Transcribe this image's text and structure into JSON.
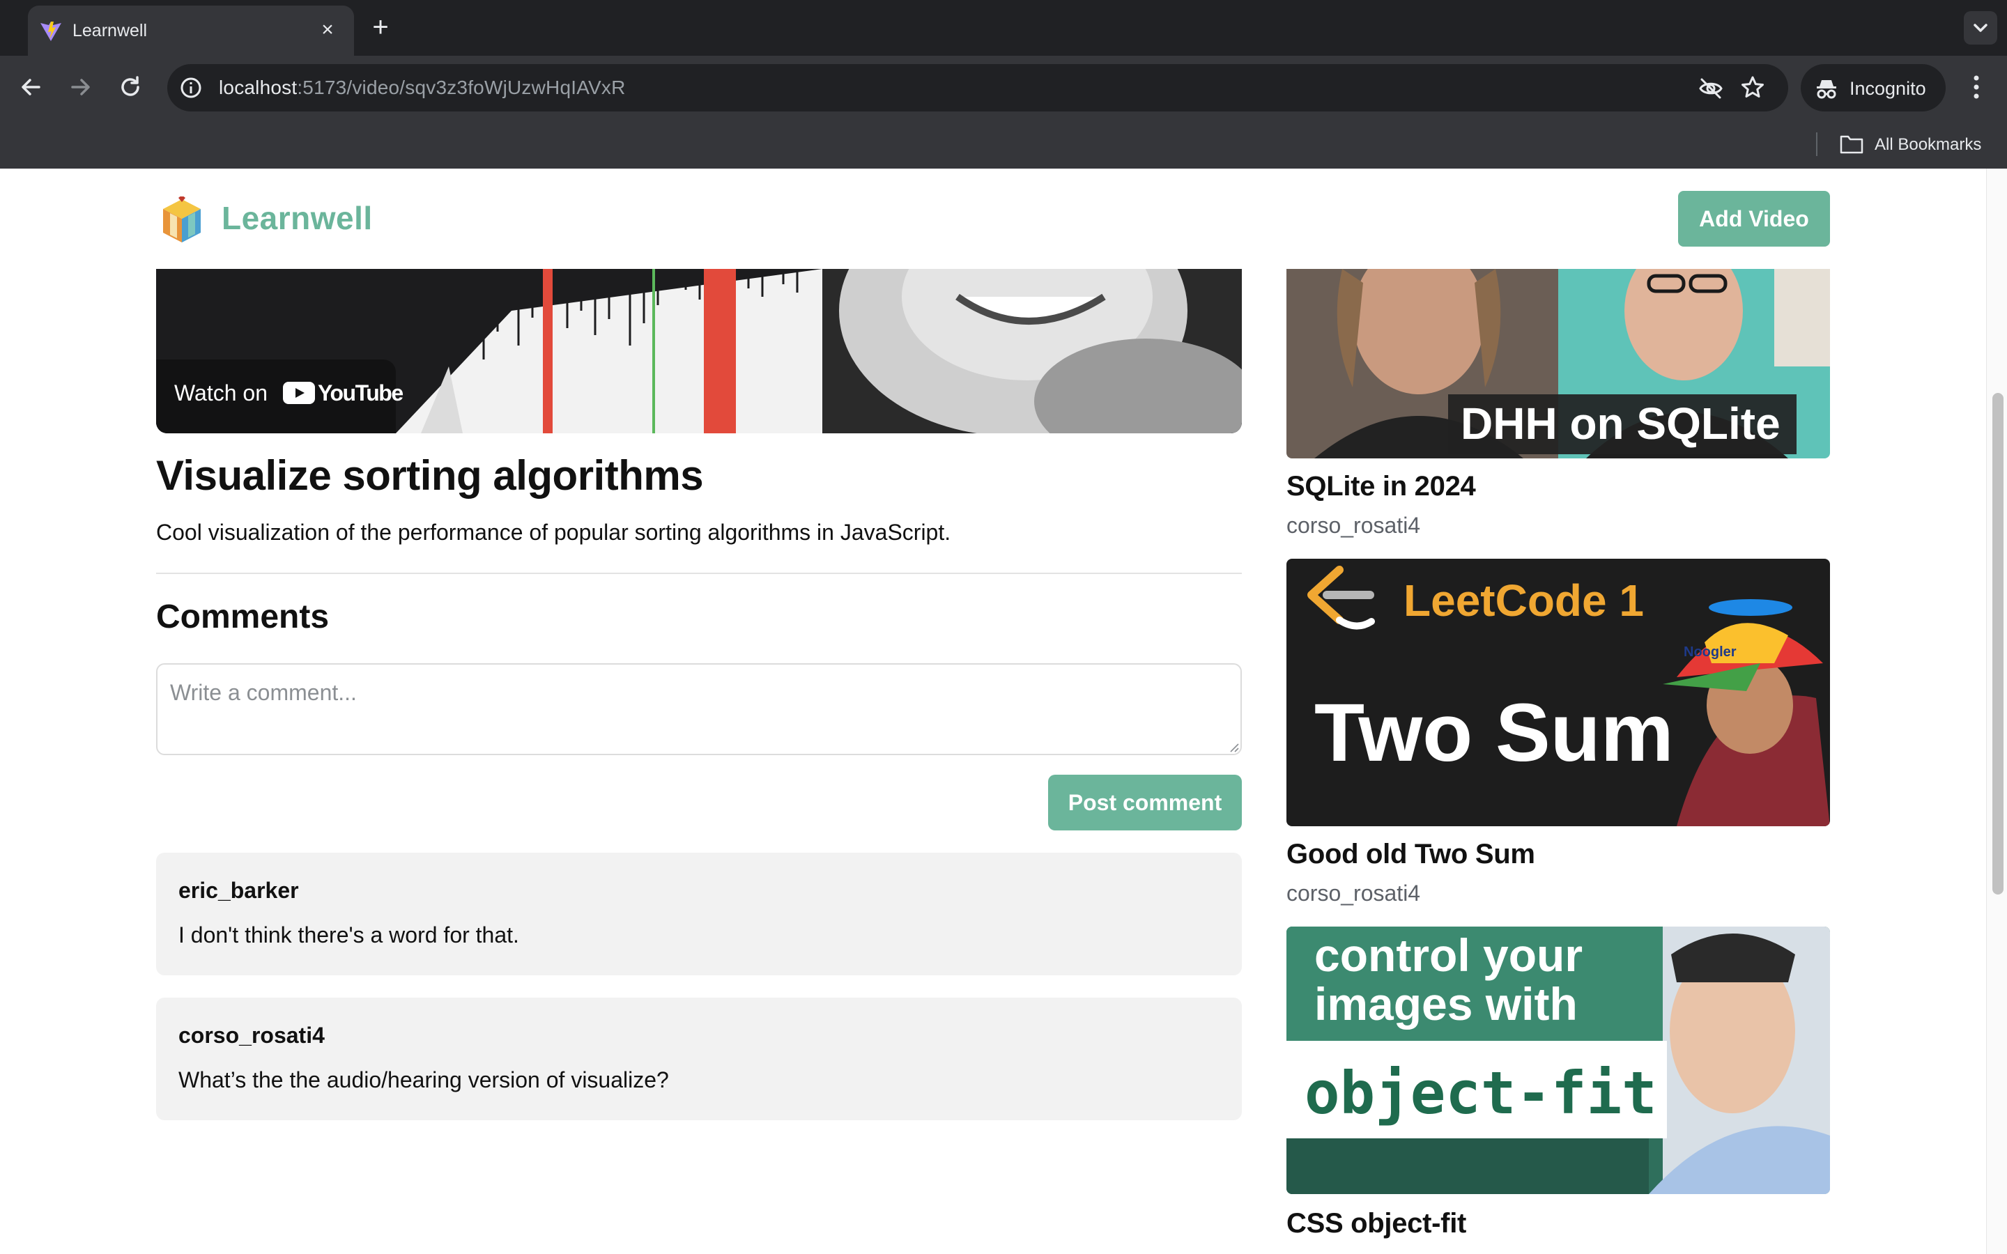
{
  "browser": {
    "tab_title": "Learnwell",
    "url_host": "localhost",
    "url_rest": ":5173/video/sqv3z3foWjUzwHqIAVxR",
    "incognito_label": "Incognito",
    "bookmarks_label": "All Bookmarks"
  },
  "header": {
    "brand": "Learnwell",
    "add_video_label": "Add Video"
  },
  "player": {
    "watch_on_label": "Watch on",
    "youtube_word": "YouTube"
  },
  "video": {
    "title": "Visualize sorting algorithms",
    "description": "Cool visualization of the performance of popular sorting algorithms in JavaScript."
  },
  "comments": {
    "heading": "Comments",
    "placeholder": "Write a comment...",
    "post_label": "Post comment",
    "items": [
      {
        "author": "eric_barker",
        "text": "I don't think there's a word for that."
      },
      {
        "author": "corso_rosati4",
        "text": "What’s the the audio/hearing version of visualize?"
      }
    ]
  },
  "related": [
    {
      "title": "SQLite in 2024",
      "author": "corso_rosati4",
      "thumb_text": "DHH on SQLite"
    },
    {
      "title": "Good old Two Sum",
      "author": "corso_rosati4",
      "thumb_text_1": "LeetCode 1",
      "thumb_text_2": "Two Sum",
      "cap_text": "Noogler"
    },
    {
      "title": "CSS object-fit",
      "author": "",
      "thumb_text_1": "control your",
      "thumb_text_2": "images with",
      "thumb_text_3": "object-fit"
    }
  ],
  "colors": {
    "accent": "#6bb59b",
    "chrome_dark": "#202124",
    "chrome_mid": "#35363a",
    "comment_bg": "#f2f2f2"
  }
}
